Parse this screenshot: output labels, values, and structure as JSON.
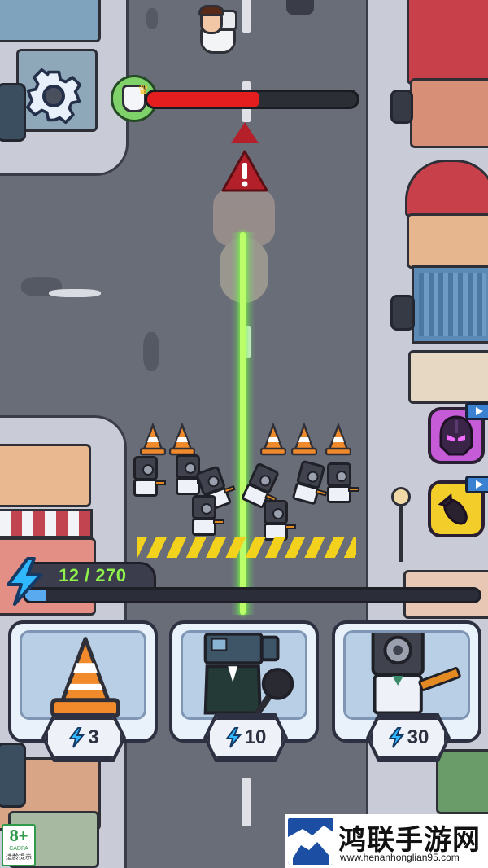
{
  "hud": {
    "settings_icon": "gear-icon",
    "boss_health": {
      "fraction": 0.53,
      "fill_color": "#e41e1e"
    },
    "energy": {
      "current_max": "12 / 270",
      "fraction": 0.044,
      "text_color": "#8ef24b"
    }
  },
  "cards": [
    {
      "name": "traffic-cone",
      "cost": "3"
    },
    {
      "name": "cameraman-agent",
      "cost": "10"
    },
    {
      "name": "speakerman-gunner",
      "cost": "30"
    }
  ],
  "side_buttons": [
    {
      "name": "titan-helmet-ability",
      "color": "#c65bd8"
    },
    {
      "name": "airstrike-bomb-ability",
      "color": "#f3cd2a"
    }
  ],
  "badge": {
    "age": "8+",
    "org": "CADPA",
    "tip": "适龄提示"
  },
  "watermark": {
    "title": "鸿联手游网",
    "url": "www.henanhonglian95.com"
  }
}
